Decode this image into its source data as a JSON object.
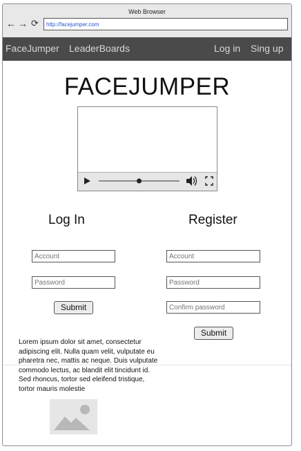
{
  "browser": {
    "title": "Web Browser",
    "url": "http://facejumper.com"
  },
  "navbar": {
    "items": [
      "FaceJumper",
      "LeaderBoards"
    ],
    "login": "Log in",
    "signup": "Sing up"
  },
  "hero": {
    "title": "FACEJUMPER"
  },
  "video": {
    "progress": 0.5
  },
  "login": {
    "title": "Log In",
    "account_placeholder": "Account",
    "password_placeholder": "Password",
    "submit": "Submit"
  },
  "register": {
    "title": "Register",
    "account_placeholder": "Account",
    "password_placeholder": "Password",
    "confirm_placeholder": "Confirm password",
    "submit": "Submit"
  },
  "body_text": "Lorem ipsum dolor sit amet, consectetur adipiscing elit. Nulla quam velit, vulputate eu pharetra nec, mattis ac neque. Duis vulputate commodo lectus, ac blandit elit tincidunt id. Sed rhoncus, tortor sed eleifend tristique, tortor mauris molestie",
  "colors": {
    "navbar_bg": "#4a4a4a",
    "url_text": "#2255cc"
  },
  "icons": [
    "back-arrow-icon",
    "forward-arrow-icon",
    "reload-icon",
    "play-icon",
    "volume-icon",
    "fullscreen-icon",
    "image-placeholder-icon"
  ]
}
